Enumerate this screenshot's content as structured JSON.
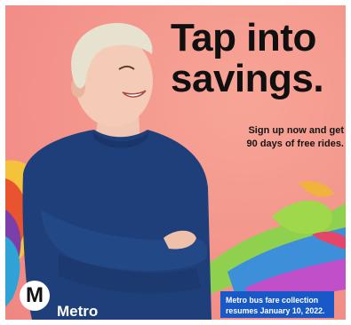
{
  "headline": {
    "line1": "Tap into",
    "line2": "savings."
  },
  "subline": {
    "line1": "Sign up now and get",
    "line2": "90 days of free rides."
  },
  "brand": {
    "logo_letter": "M",
    "wordmark": "Metro"
  },
  "notice": {
    "line1": "Metro bus fare collection",
    "line2": "resumes January 10, 2022."
  },
  "colors": {
    "background": "#f59a8c",
    "notice_bg": "#1958c7",
    "sweater": "#1f3f7a"
  }
}
